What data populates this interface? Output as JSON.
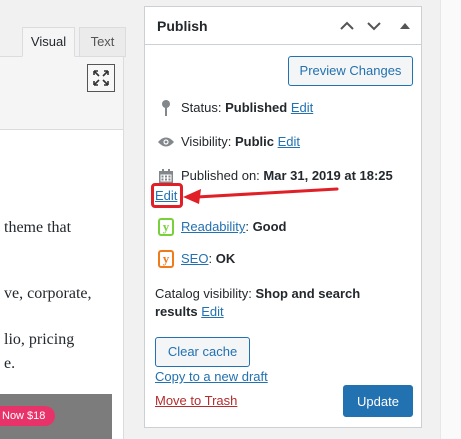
{
  "editor": {
    "tabs": [
      {
        "label": "Visual"
      },
      {
        "label": "Text"
      }
    ],
    "content_lines": [
      "theme that",
      "ve, corporate,",
      "lio, pricing",
      "e."
    ],
    "badge_text": "Now $18"
  },
  "publish": {
    "title": "Publish",
    "preview_label": "Preview Changes",
    "status": {
      "label": "Status:",
      "value": "Published",
      "edit": "Edit"
    },
    "visibility": {
      "label": "Visibility:",
      "value": "Public",
      "edit": "Edit"
    },
    "published_on": {
      "label": "Published on:",
      "value": "Mar 31, 2019 at 18:25",
      "edit": "Edit"
    },
    "readability": {
      "label": "Readability",
      "value": "Good"
    },
    "seo": {
      "label": "SEO",
      "value": "OK"
    },
    "catalog": {
      "label": "Catalog visibility:",
      "value_line1": "Shop and search",
      "value_line2": "results",
      "edit": "Edit"
    },
    "clear_cache_label": "Clear cache",
    "copy_draft_label": "Copy to a new draft",
    "trash_label": "Move to Trash",
    "update_label": "Update"
  },
  "colors": {
    "accent": "#2271b1",
    "annotation": "#e01f26",
    "readability_good": "#7ad03a",
    "seo_ok": "#ee7c1b",
    "trash": "#b32d2e"
  },
  "icons": [
    "fullscreen-icon",
    "chevron-up-icon",
    "chevron-down-icon",
    "collapse-triangle-icon",
    "pin-icon",
    "eye-icon",
    "calendar-icon",
    "yoast-icon",
    "arrow-annotation-icon"
  ]
}
